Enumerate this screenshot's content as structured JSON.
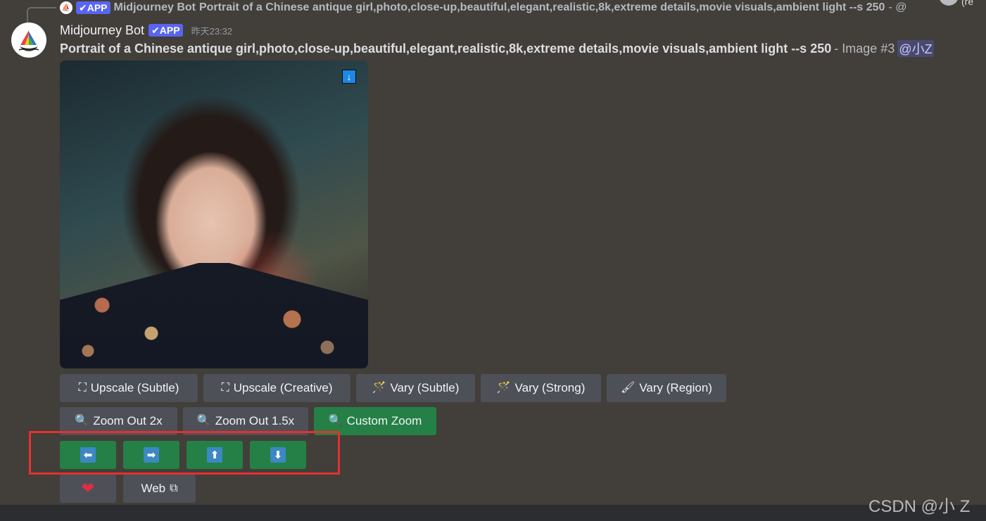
{
  "reply": {
    "badge": "✔APP",
    "author": "Midjourney Bot",
    "text": "Portrait of a Chinese antique girl,photo,close-up,beautiful,elegant,realistic,8k,extreme details,movie visuals,ambient light --s 250",
    "tail": "- @",
    "truncated": "(re"
  },
  "message": {
    "author": "Midjourney Bot",
    "badge": "✔APP",
    "timestamp": "昨天23:32",
    "prompt": "Portrait of a Chinese antique girl,photo,close-up,beautiful,elegant,realistic,8k,extreme details,movie visuals,ambient light --s 250",
    "meta": "- Image #3",
    "mention": "@小Z"
  },
  "image": {
    "description_icon": "download-icon",
    "download_glyph": "↓"
  },
  "buttons": {
    "row1": [
      {
        "icon": "⛶",
        "label": "Upscale (Subtle)"
      },
      {
        "icon": "⛶",
        "label": "Upscale (Creative)"
      },
      {
        "icon": "🪄",
        "label": "Vary (Subtle)"
      },
      {
        "icon": "🪄",
        "label": "Vary (Strong)"
      },
      {
        "icon": "🖌",
        "label": "Vary (Region)"
      }
    ],
    "row2": [
      {
        "icon": "🔍",
        "label": "Zoom Out 2x"
      },
      {
        "icon": "🔍",
        "label": "Zoom Out 1.5x"
      },
      {
        "icon": "🔍",
        "label": "Custom Zoom"
      }
    ],
    "pan": [
      "⬅",
      "➡",
      "⬆",
      "⬇"
    ],
    "heart": "❤",
    "web_label": "Web",
    "web_icon": "⧉"
  },
  "watermark": "CSDN @小 Z",
  "colors": {
    "background": "#423e39",
    "button": "#4e5058",
    "button_green": "#248046",
    "highlight": "#e53030",
    "badge": "#5865f2"
  }
}
